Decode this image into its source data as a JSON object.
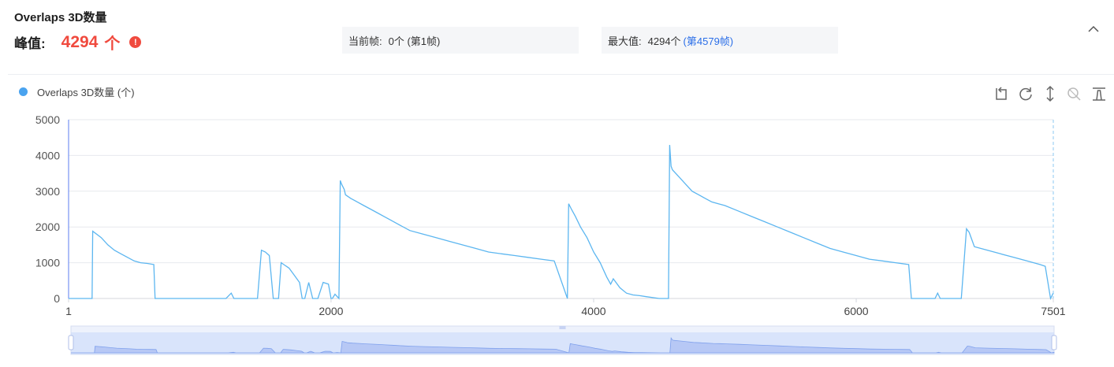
{
  "header": {
    "title": "Overlaps 3D数量",
    "peak_label": "峰值:",
    "peak_value": "4294",
    "peak_unit": "个"
  },
  "current_frame": {
    "label": "当前帧:",
    "value": "0个 (第1帧)"
  },
  "max_value": {
    "label": "最大值:",
    "value": "4294个",
    "frame_link": "(第4579帧)"
  },
  "icons": {
    "alert": "exclamation-circle-icon",
    "collapse": "chevron-up-icon",
    "tools": [
      "zoom-back-icon",
      "restore-icon",
      "vertical-zoom-icon",
      "zoom-disabled-icon",
      "save-image-icon"
    ]
  },
  "colors": {
    "series": "#5cb6f0",
    "alert": "#f04a3e",
    "link": "#2a6ee8",
    "slider_fill": "#c9d8fa"
  },
  "chart_data": {
    "type": "line",
    "title": "",
    "xlabel": "",
    "ylabel": "",
    "xlim": [
      1,
      7501
    ],
    "ylim": [
      0,
      5000
    ],
    "x_ticks": [
      {
        "value": 1,
        "label": "1"
      },
      {
        "value": 2000,
        "label": "2000"
      },
      {
        "value": 4000,
        "label": "4000"
      },
      {
        "value": 6000,
        "label": "6000"
      },
      {
        "value": 7501,
        "label": "7501"
      }
    ],
    "y_ticks": [
      {
        "value": 0,
        "label": "0"
      },
      {
        "value": 1000,
        "label": "1000"
      },
      {
        "value": 2000,
        "label": "2000"
      },
      {
        "value": 3000,
        "label": "3000"
      },
      {
        "value": 4000,
        "label": "4000"
      },
      {
        "value": 5000,
        "label": "5000"
      }
    ],
    "grid": true,
    "legend_position": "top-left",
    "series": [
      {
        "name": "Overlaps 3D数量 (个)",
        "x": [
          1,
          180,
          185,
          250,
          300,
          350,
          400,
          450,
          500,
          550,
          600,
          650,
          660,
          700,
          720,
          740,
          760,
          800,
          1200,
          1240,
          1260,
          1300,
          1440,
          1470,
          1500,
          1530,
          1560,
          1600,
          1620,
          1640,
          1680,
          1720,
          1760,
          1780,
          1800,
          1830,
          1860,
          1880,
          1900,
          1940,
          1980,
          2000,
          2010,
          2030,
          2060,
          2070,
          2080,
          2100,
          2110,
          2150,
          2200,
          2250,
          2300,
          2350,
          2400,
          2450,
          2500,
          2600,
          2700,
          2800,
          2900,
          3000,
          3100,
          3200,
          3300,
          3400,
          3500,
          3600,
          3700,
          3800,
          3810,
          3830,
          3860,
          3900,
          3950,
          4000,
          4050,
          4100,
          4130,
          4150,
          4200,
          4250,
          4300,
          4350,
          4400,
          4500,
          4570,
          4579,
          4590,
          4600,
          4650,
          4700,
          4750,
          4800,
          4850,
          4900,
          4950,
          5000,
          5100,
          5200,
          5300,
          5400,
          5500,
          5600,
          5700,
          5800,
          5900,
          6000,
          6100,
          6200,
          6300,
          6400,
          6420,
          6600,
          6620,
          6640,
          6700,
          6800,
          6840,
          6860,
          6900,
          7000,
          7100,
          7200,
          7300,
          7400,
          7440,
          7480,
          7501
        ],
        "y": [
          0,
          0,
          1880,
          1700,
          1500,
          1350,
          1250,
          1150,
          1050,
          1000,
          980,
          950,
          0,
          0,
          0,
          0,
          0,
          0,
          0,
          150,
          0,
          0,
          0,
          1350,
          1300,
          1200,
          0,
          0,
          1000,
          950,
          850,
          650,
          450,
          0,
          0,
          450,
          0,
          0,
          0,
          450,
          400,
          0,
          0,
          120,
          0,
          3300,
          3200,
          3050,
          2900,
          2800,
          2700,
          2600,
          2500,
          2400,
          2300,
          2200,
          2100,
          1900,
          1800,
          1700,
          1600,
          1500,
          1400,
          1300,
          1250,
          1200,
          1150,
          1100,
          1050,
          0,
          2650,
          2500,
          2300,
          2000,
          1700,
          1300,
          1000,
          600,
          400,
          550,
          300,
          150,
          100,
          80,
          50,
          0,
          0,
          4294,
          3700,
          3600,
          3400,
          3200,
          3000,
          2900,
          2800,
          2700,
          2650,
          2600,
          2450,
          2300,
          2150,
          2000,
          1850,
          1700,
          1550,
          1400,
          1300,
          1200,
          1100,
          1050,
          1000,
          950,
          0,
          0,
          150,
          0,
          0,
          0,
          1950,
          1850,
          1450,
          1350,
          1250,
          1150,
          1050,
          950,
          900,
          0,
          150
        ]
      }
    ]
  }
}
